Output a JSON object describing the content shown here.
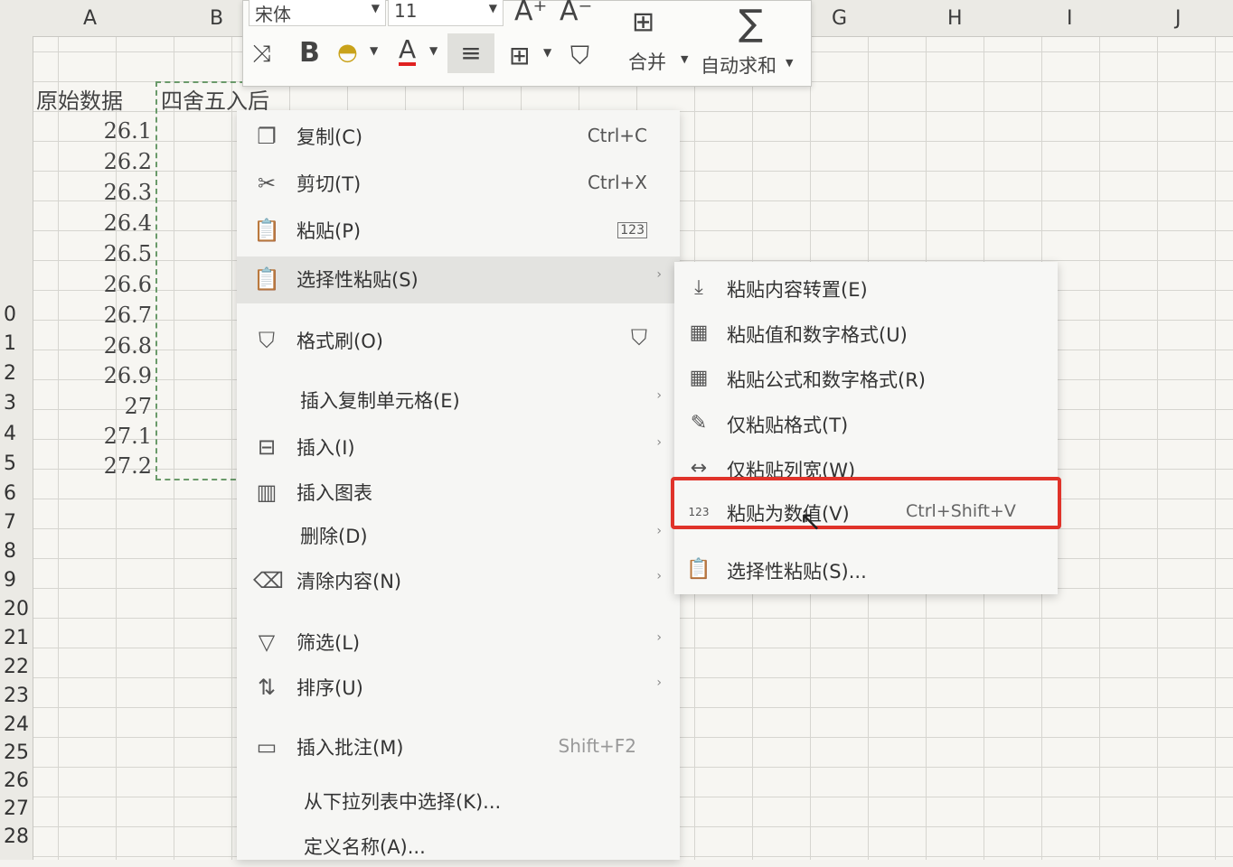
{
  "columns": [
    "A",
    "B",
    "G",
    "H",
    "I",
    "J"
  ],
  "rows": [
    "",
    "",
    "",
    "0",
    "1",
    "2",
    "3",
    "4",
    "5",
    "6",
    "7",
    "8",
    "9",
    "20",
    "21",
    "22",
    "23",
    "24",
    "25",
    "26",
    "27",
    "28"
  ],
  "cells": {
    "header_a": "原始数据",
    "header_b": "四舍五入后",
    "values": [
      "26.1",
      "26.2",
      "26.3",
      "26.4",
      "26.5",
      "26.6",
      "26.7",
      "26.8",
      "26.9",
      "27",
      "27.1",
      "27.2"
    ]
  },
  "toolbar": {
    "font_name": "宋体",
    "font_size": "11",
    "bold": "B",
    "font_color": "A",
    "merge_label": "合并",
    "autosum_label": "自动求和",
    "sigma": "∑",
    "increase_font": "A⁺",
    "decrease_font": "A⁻"
  },
  "context_menu": [
    {
      "label": "复制(C)",
      "shortcut": "Ctrl+C",
      "icon": "copy-icon"
    },
    {
      "label": "剪切(T)",
      "shortcut": "Ctrl+X",
      "icon": "scissors-icon"
    },
    {
      "label": "粘贴(P)",
      "shortcut": "",
      "icon": "paste-icon"
    },
    {
      "label": "选择性粘贴(S)",
      "shortcut": "",
      "icon": "paste-special-icon",
      "submenu": true
    },
    {
      "label": "格式刷(O)",
      "shortcut": "",
      "icon": "format-painter-icon"
    },
    {
      "label": "插入复制单元格(E)",
      "shortcut": "",
      "icon": "",
      "submenu": true
    },
    {
      "label": "插入(I)",
      "shortcut": "",
      "icon": "insert-icon",
      "submenu": true
    },
    {
      "label": "插入图表",
      "shortcut": "",
      "icon": "chart-icon"
    },
    {
      "label": "删除(D)",
      "shortcut": "",
      "icon": "",
      "submenu": true
    },
    {
      "label": "清除内容(N)",
      "shortcut": "",
      "icon": "eraser-icon",
      "submenu": true
    },
    {
      "label": "筛选(L)",
      "shortcut": "",
      "icon": "filter-icon",
      "submenu": true
    },
    {
      "label": "排序(U)",
      "shortcut": "",
      "icon": "sort-icon",
      "submenu": true
    },
    {
      "label": "插入批注(M)",
      "shortcut": "Shift+F2",
      "icon": "comment-icon"
    },
    {
      "label": "从下拉列表中选择(K)...",
      "shortcut": "",
      "icon": ""
    },
    {
      "label": "定义名称(A)...",
      "shortcut": "",
      "icon": ""
    }
  ],
  "submenu": [
    {
      "label": "粘贴内容转置(E)",
      "shortcut": "",
      "icon": "transpose-icon"
    },
    {
      "label": "粘贴值和数字格式(U)",
      "shortcut": "",
      "icon": "paste-values-format-icon"
    },
    {
      "label": "粘贴公式和数字格式(R)",
      "shortcut": "",
      "icon": "paste-formula-icon"
    },
    {
      "label": "仅粘贴格式(T)",
      "shortcut": "",
      "icon": "paste-format-icon"
    },
    {
      "label": "仅粘贴列宽(W)",
      "shortcut": "",
      "icon": "paste-width-icon"
    },
    {
      "label": "粘贴为数值(V)",
      "shortcut": "Ctrl+Shift+V",
      "icon": "paste-values-icon"
    },
    {
      "label": "选择性粘贴(S)...",
      "shortcut": "",
      "icon": "paste-special-icon"
    }
  ],
  "colors": {
    "highlight": "#e0332a",
    "menu_bg": "#f6f6f4"
  }
}
